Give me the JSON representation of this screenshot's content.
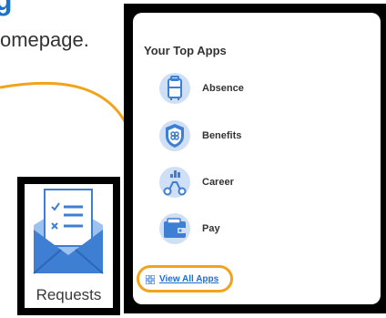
{
  "partial": {
    "title": "g",
    "text": "omepage."
  },
  "apps_panel": {
    "title": "Your Top Apps",
    "items": [
      {
        "label": "Absence",
        "icon": "suitcase-icon"
      },
      {
        "label": "Benefits",
        "icon": "shield-icon"
      },
      {
        "label": "Career",
        "icon": "career-icon"
      },
      {
        "label": "Pay",
        "icon": "wallet-icon"
      }
    ],
    "view_all": {
      "label": "View All Apps",
      "icon": "grid-icon"
    }
  },
  "requests_tile": {
    "label": "Requests",
    "icon": "envelope-checklist-icon"
  },
  "colors": {
    "accent_orange": "#f2a31b",
    "link_blue": "#1a6ed8",
    "icon_blue": "#3e7fd4",
    "icon_light": "#cfe0f6"
  }
}
